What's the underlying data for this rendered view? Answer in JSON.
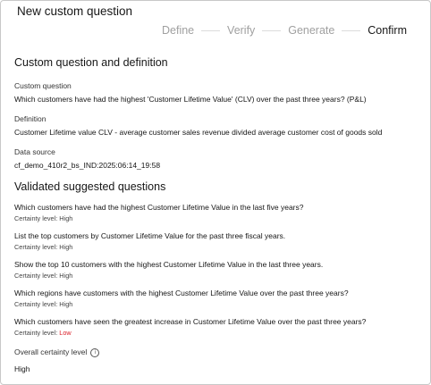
{
  "dialog": {
    "title": "New custom question"
  },
  "steps": [
    {
      "label": "Define",
      "active": false
    },
    {
      "label": "Verify",
      "active": false
    },
    {
      "label": "Generate",
      "active": false
    },
    {
      "label": "Confirm",
      "active": true
    }
  ],
  "definition_section": {
    "title": "Custom question and definition",
    "custom_question_label": "Custom question",
    "custom_question_value": "Which customers have had the highest 'Customer Lifetime Value' (CLV) over the past three years? (P&L)",
    "definition_label": "Definition",
    "definition_value": "Customer Lifetime value CLV - average customer sales revenue divided average customer cost of goods sold",
    "data_source_label": "Data source",
    "data_source_value": "cf_demo_410r2_bs_IND:2025:06:14_19:58"
  },
  "validated_section": {
    "title": "Validated suggested questions",
    "certainty_prefix": "Certainty level: ",
    "questions": [
      {
        "text": "Which customers have had the highest Customer Lifetime Value in the last five years?",
        "certainty": "High"
      },
      {
        "text": "List the top customers by Customer Lifetime Value for the past three fiscal years.",
        "certainty": "High"
      },
      {
        "text": "Show the top 10 customers with the highest Customer Lifetime Value in the last three years.",
        "certainty": "High"
      },
      {
        "text": "Which regions have customers with the highest Customer Lifetime Value over the past three years?",
        "certainty": "High"
      },
      {
        "text": "Which customers have seen the greatest increase in Customer Lifetime Value over the past three years?",
        "certainty": "Low"
      }
    ],
    "overall_label": "Overall certainty level",
    "overall_value": "High"
  },
  "colors": {
    "low_certainty": "#da1e28",
    "active_step": "#161616",
    "inactive_step": "#a0a0a0"
  },
  "icons": {
    "overall_info": "info-icon"
  }
}
